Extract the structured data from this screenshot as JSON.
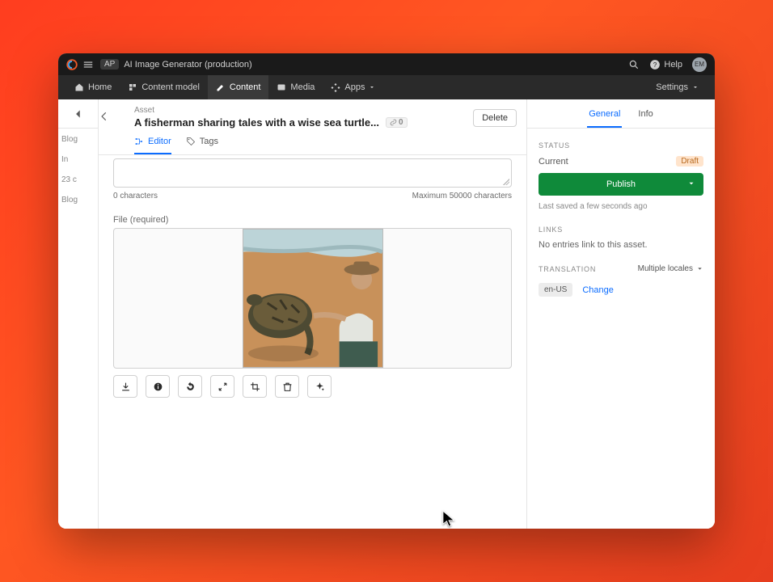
{
  "titlebar": {
    "badge": "AP",
    "title": "AI Image Generator (production)",
    "help": "Help",
    "avatar_initials": "EM"
  },
  "nav": {
    "home": "Home",
    "content_model": "Content model",
    "content": "Content",
    "media": "Media",
    "apps": "Apps",
    "settings": "Settings"
  },
  "left_snippets": [
    "Blog",
    "In",
    "23 c",
    "Blog"
  ],
  "entry": {
    "type_label": "Asset",
    "title": "A fisherman sharing tales with a wise sea turtle...",
    "ref_count": "0",
    "delete": "Delete"
  },
  "editor_tabs": {
    "editor": "Editor",
    "tags": "Tags"
  },
  "textarea": {
    "char_left": "0 characters",
    "char_right": "Maximum 50000 characters"
  },
  "file": {
    "label": "File (required)"
  },
  "tools": {
    "download": "download-icon",
    "info": "info-icon",
    "rotate": "rotate-icon",
    "resize": "resize-icon",
    "crop": "crop-icon",
    "delete": "trash-icon",
    "ai": "sparkle-icon"
  },
  "right": {
    "tab_general": "General",
    "tab_info": "Info",
    "status_label": "STATUS",
    "current": "Current",
    "status_value": "Draft",
    "publish": "Publish",
    "saved": "Last saved a few seconds ago",
    "links_label": "LINKS",
    "links_empty": "No entries link to this asset.",
    "translation_label": "TRANSLATION",
    "multi_locales": "Multiple locales",
    "locale": "en-US",
    "change": "Change"
  }
}
